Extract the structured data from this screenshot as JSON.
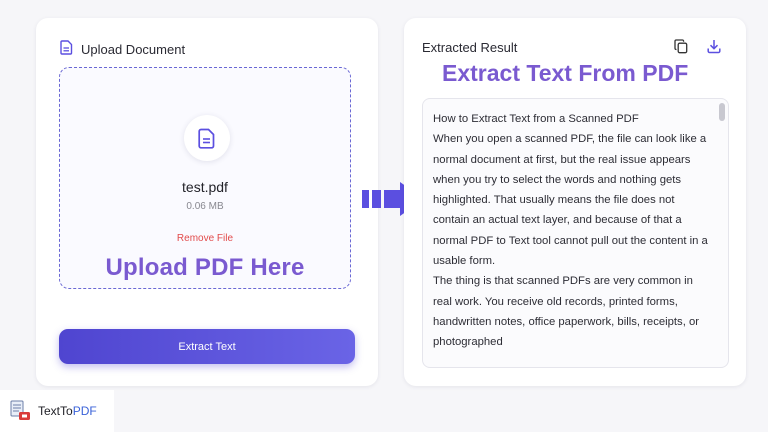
{
  "upload_panel": {
    "title": "Upload Document",
    "file_name": "test.pdf",
    "file_size": "0.06 MB",
    "remove_label": "Remove File",
    "overlay_caption": "Upload PDF Here",
    "extract_button_label": "Extract Text"
  },
  "result_panel": {
    "title": "Extracted Result",
    "overlay_caption": "Extract Text From PDF",
    "paragraphs": [
      "How to Extract Text from a Scanned PDF",
      "When you open a scanned PDF, the file can look like a normal document at first, but the real issue appears when you try to select the words and nothing gets highlighted. That usually means the file does not contain an actual text layer, and because of that a normal PDF to Text tool cannot pull out the content in a usable form.",
      "The thing is that scanned PDFs are very common in real work. You receive old records, printed forms, handwritten notes, office paperwork, bills, receipts, or photographed"
    ]
  },
  "brand": {
    "name_part1": "TextTo",
    "name_part2": "PDF"
  },
  "icons": {
    "document_icon": "document-icon",
    "file_icon": "pdf-file-icon",
    "copy_icon": "copy-icon",
    "download_icon": "download-icon",
    "arrow_icon": "arrow-right-icon",
    "logo_icon": "texttopdf-logo-icon"
  },
  "colors": {
    "accent": "#4f45d0",
    "overlay_text": "#7a5ad0",
    "remove": "#e24b4b",
    "arrow": "#5b4fe0"
  }
}
